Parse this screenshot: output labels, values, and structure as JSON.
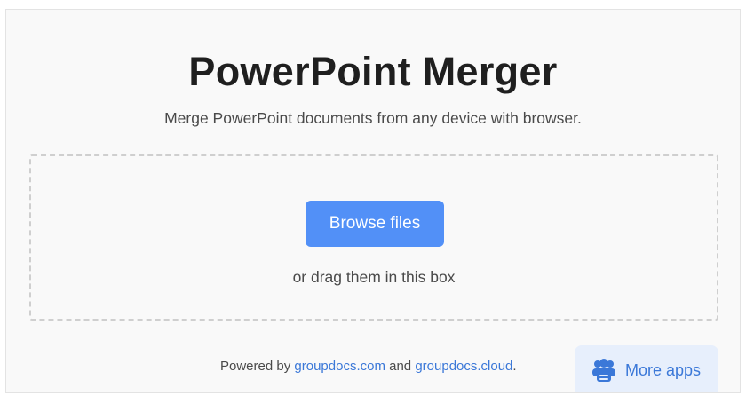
{
  "header": {
    "title": "PowerPoint Merger",
    "subtitle": "Merge PowerPoint documents from any device with browser."
  },
  "upload": {
    "browse_label": "Browse files",
    "drag_hint": "or drag them in this box"
  },
  "footer": {
    "powered_by": "Powered by ",
    "link1": "groupdocs.com",
    "and": " and ",
    "link2": "groupdocs.cloud",
    "period": "."
  },
  "more_apps": {
    "label": "More apps",
    "icon": "users-group-icon"
  },
  "colors": {
    "accent": "#5290f7",
    "link": "#3b78d8",
    "more_apps_bg": "#e7effc"
  }
}
